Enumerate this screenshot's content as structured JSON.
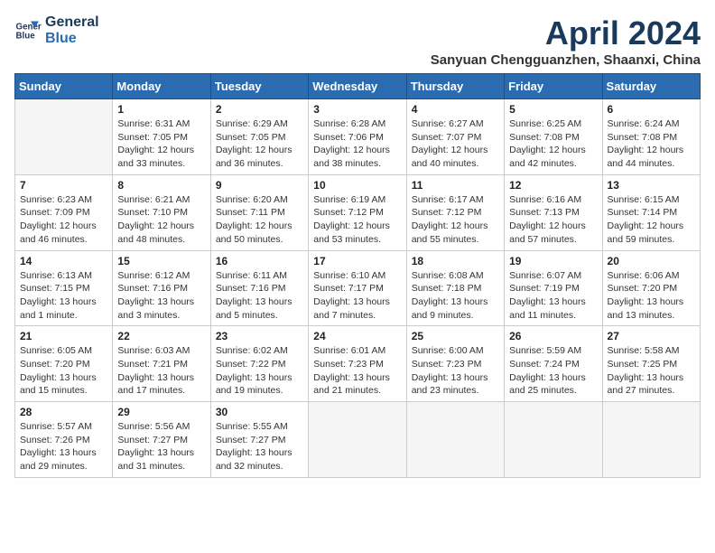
{
  "logo": {
    "line1": "General",
    "line2": "Blue"
  },
  "title": "April 2024",
  "subtitle": "Sanyuan Chengguanzhen, Shaanxi, China",
  "weekdays": [
    "Sunday",
    "Monday",
    "Tuesday",
    "Wednesday",
    "Thursday",
    "Friday",
    "Saturday"
  ],
  "weeks": [
    [
      {
        "day": null
      },
      {
        "day": "1",
        "sunrise": "6:31 AM",
        "sunset": "7:05 PM",
        "daylight": "12 hours and 33 minutes."
      },
      {
        "day": "2",
        "sunrise": "6:29 AM",
        "sunset": "7:05 PM",
        "daylight": "12 hours and 36 minutes."
      },
      {
        "day": "3",
        "sunrise": "6:28 AM",
        "sunset": "7:06 PM",
        "daylight": "12 hours and 38 minutes."
      },
      {
        "day": "4",
        "sunrise": "6:27 AM",
        "sunset": "7:07 PM",
        "daylight": "12 hours and 40 minutes."
      },
      {
        "day": "5",
        "sunrise": "6:25 AM",
        "sunset": "7:08 PM",
        "daylight": "12 hours and 42 minutes."
      },
      {
        "day": "6",
        "sunrise": "6:24 AM",
        "sunset": "7:08 PM",
        "daylight": "12 hours and 44 minutes."
      }
    ],
    [
      {
        "day": "7",
        "sunrise": "6:23 AM",
        "sunset": "7:09 PM",
        "daylight": "12 hours and 46 minutes."
      },
      {
        "day": "8",
        "sunrise": "6:21 AM",
        "sunset": "7:10 PM",
        "daylight": "12 hours and 48 minutes."
      },
      {
        "day": "9",
        "sunrise": "6:20 AM",
        "sunset": "7:11 PM",
        "daylight": "12 hours and 50 minutes."
      },
      {
        "day": "10",
        "sunrise": "6:19 AM",
        "sunset": "7:12 PM",
        "daylight": "12 hours and 53 minutes."
      },
      {
        "day": "11",
        "sunrise": "6:17 AM",
        "sunset": "7:12 PM",
        "daylight": "12 hours and 55 minutes."
      },
      {
        "day": "12",
        "sunrise": "6:16 AM",
        "sunset": "7:13 PM",
        "daylight": "12 hours and 57 minutes."
      },
      {
        "day": "13",
        "sunrise": "6:15 AM",
        "sunset": "7:14 PM",
        "daylight": "12 hours and 59 minutes."
      }
    ],
    [
      {
        "day": "14",
        "sunrise": "6:13 AM",
        "sunset": "7:15 PM",
        "daylight": "13 hours and 1 minute."
      },
      {
        "day": "15",
        "sunrise": "6:12 AM",
        "sunset": "7:16 PM",
        "daylight": "13 hours and 3 minutes."
      },
      {
        "day": "16",
        "sunrise": "6:11 AM",
        "sunset": "7:16 PM",
        "daylight": "13 hours and 5 minutes."
      },
      {
        "day": "17",
        "sunrise": "6:10 AM",
        "sunset": "7:17 PM",
        "daylight": "13 hours and 7 minutes."
      },
      {
        "day": "18",
        "sunrise": "6:08 AM",
        "sunset": "7:18 PM",
        "daylight": "13 hours and 9 minutes."
      },
      {
        "day": "19",
        "sunrise": "6:07 AM",
        "sunset": "7:19 PM",
        "daylight": "13 hours and 11 minutes."
      },
      {
        "day": "20",
        "sunrise": "6:06 AM",
        "sunset": "7:20 PM",
        "daylight": "13 hours and 13 minutes."
      }
    ],
    [
      {
        "day": "21",
        "sunrise": "6:05 AM",
        "sunset": "7:20 PM",
        "daylight": "13 hours and 15 minutes."
      },
      {
        "day": "22",
        "sunrise": "6:03 AM",
        "sunset": "7:21 PM",
        "daylight": "13 hours and 17 minutes."
      },
      {
        "day": "23",
        "sunrise": "6:02 AM",
        "sunset": "7:22 PM",
        "daylight": "13 hours and 19 minutes."
      },
      {
        "day": "24",
        "sunrise": "6:01 AM",
        "sunset": "7:23 PM",
        "daylight": "13 hours and 21 minutes."
      },
      {
        "day": "25",
        "sunrise": "6:00 AM",
        "sunset": "7:23 PM",
        "daylight": "13 hours and 23 minutes."
      },
      {
        "day": "26",
        "sunrise": "5:59 AM",
        "sunset": "7:24 PM",
        "daylight": "13 hours and 25 minutes."
      },
      {
        "day": "27",
        "sunrise": "5:58 AM",
        "sunset": "7:25 PM",
        "daylight": "13 hours and 27 minutes."
      }
    ],
    [
      {
        "day": "28",
        "sunrise": "5:57 AM",
        "sunset": "7:26 PM",
        "daylight": "13 hours and 29 minutes."
      },
      {
        "day": "29",
        "sunrise": "5:56 AM",
        "sunset": "7:27 PM",
        "daylight": "13 hours and 31 minutes."
      },
      {
        "day": "30",
        "sunrise": "5:55 AM",
        "sunset": "7:27 PM",
        "daylight": "13 hours and 32 minutes."
      },
      {
        "day": null
      },
      {
        "day": null
      },
      {
        "day": null
      },
      {
        "day": null
      }
    ]
  ]
}
